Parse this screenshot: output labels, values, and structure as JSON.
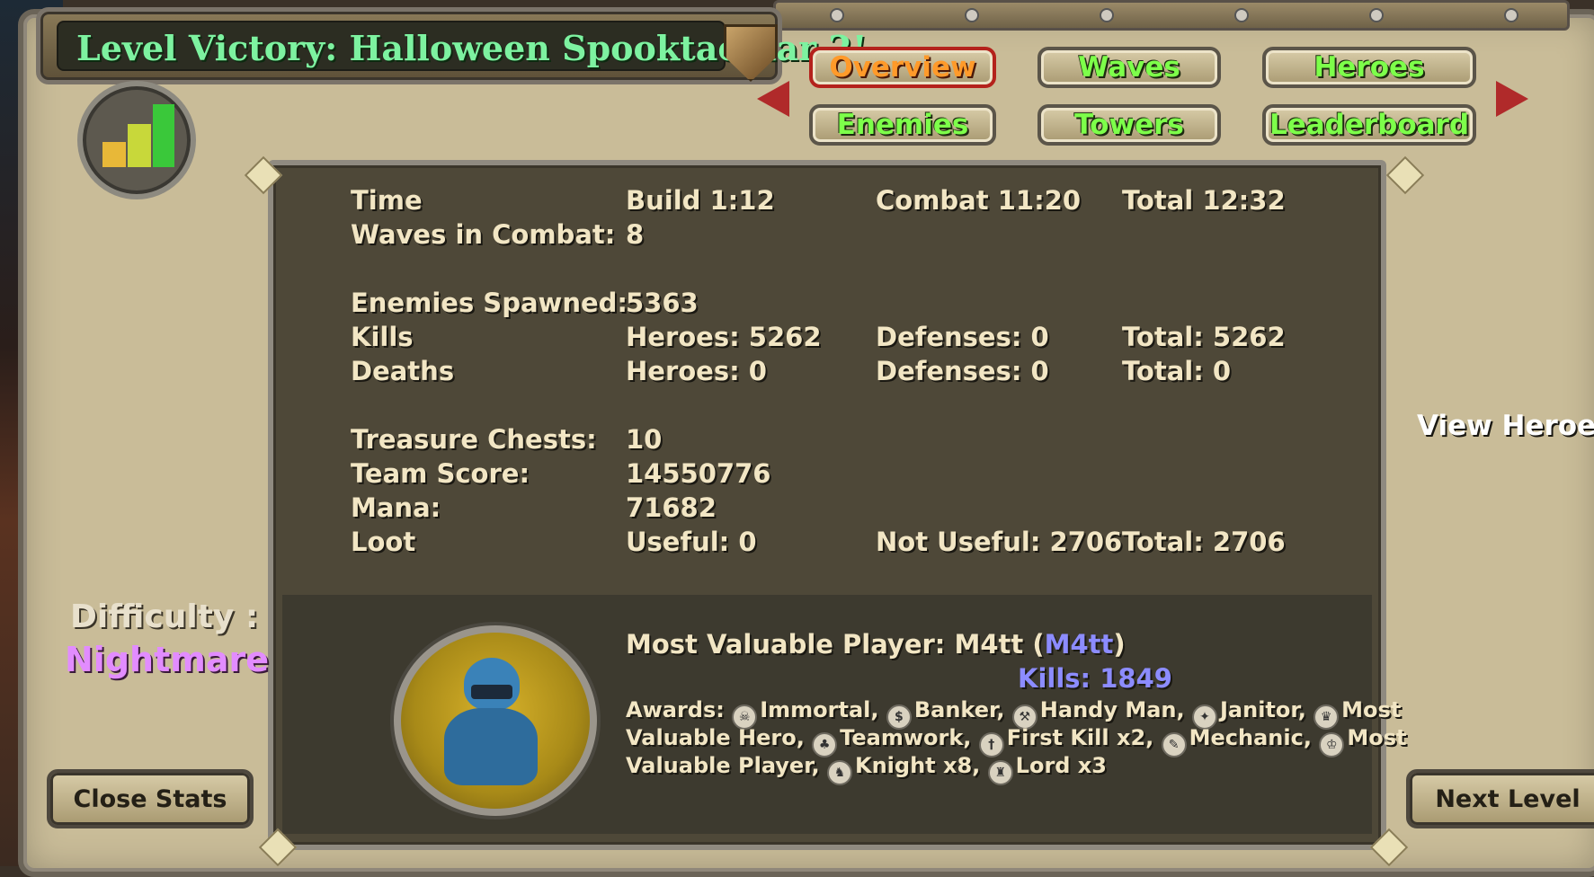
{
  "title": "Level Victory: Halloween Spooktacular 2!",
  "tabs": [
    {
      "label": "Overview",
      "active": true
    },
    {
      "label": "Waves",
      "active": false
    },
    {
      "label": "Heroes",
      "active": false
    },
    {
      "label": "Enemies",
      "active": false
    },
    {
      "label": "Towers",
      "active": false
    },
    {
      "label": "Leaderboard",
      "active": false
    }
  ],
  "stats": {
    "time": {
      "label": "Time",
      "build": "Build 1:12",
      "combat": "Combat 11:20",
      "total": "Total 12:32"
    },
    "waves": {
      "label": "Waves in Combat:",
      "value": "8"
    },
    "enemies_spawned": {
      "label": "Enemies Spawned:",
      "value": "5363"
    },
    "kills": {
      "label": "Kills",
      "heroes": "Heroes: 5262",
      "defenses": "Defenses: 0",
      "total": "Total: 5262"
    },
    "deaths": {
      "label": "Deaths",
      "heroes": "Heroes: 0",
      "defenses": "Defenses: 0",
      "total": "Total: 0"
    },
    "treasure": {
      "label": "Treasure Chests:",
      "value": "10"
    },
    "team_score": {
      "label": "Team Score:",
      "value": "14550776"
    },
    "mana": {
      "label": "Mana:",
      "value": "71682"
    },
    "loot": {
      "label": "Loot",
      "useful": "Useful: 0",
      "not_useful": "Not Useful: 2706",
      "total": "Total: 2706"
    }
  },
  "mvp": {
    "prefix": "Most Valuable Player: M4tt (",
    "name": "M4tt",
    "suffix": ")",
    "kills": "Kills: 1849",
    "awards_line1": [
      "Awards:",
      "Immortal,",
      "Banker,",
      "Handy Man,",
      "Janitor,",
      "Most"
    ],
    "awards_line2": [
      "Valuable Hero,",
      "Teamwork,",
      "First Kill x2,",
      "Mechanic,",
      "Most"
    ],
    "awards_line3": [
      "Valuable Player,",
      "Knight x8,",
      "Lord x3"
    ]
  },
  "difficulty": {
    "label": "Difficulty :",
    "value": "Nightmare"
  },
  "buttons": {
    "close_stats": "Close Stats",
    "next_level": "Next Level",
    "view_heroes": "View Heroes"
  },
  "colors": {
    "tab_text": "#7dff4a",
    "tab_active_text": "#ff9a2a",
    "title_text": "#7df2a0",
    "mvp_name": "#8c8cff",
    "difficulty": "#e28cff"
  },
  "icons": {
    "stats": "bar-chart-icon",
    "nav_prev": "arrow-left-icon",
    "nav_next": "arrow-right-icon",
    "title_emblem": "shield-icon"
  }
}
